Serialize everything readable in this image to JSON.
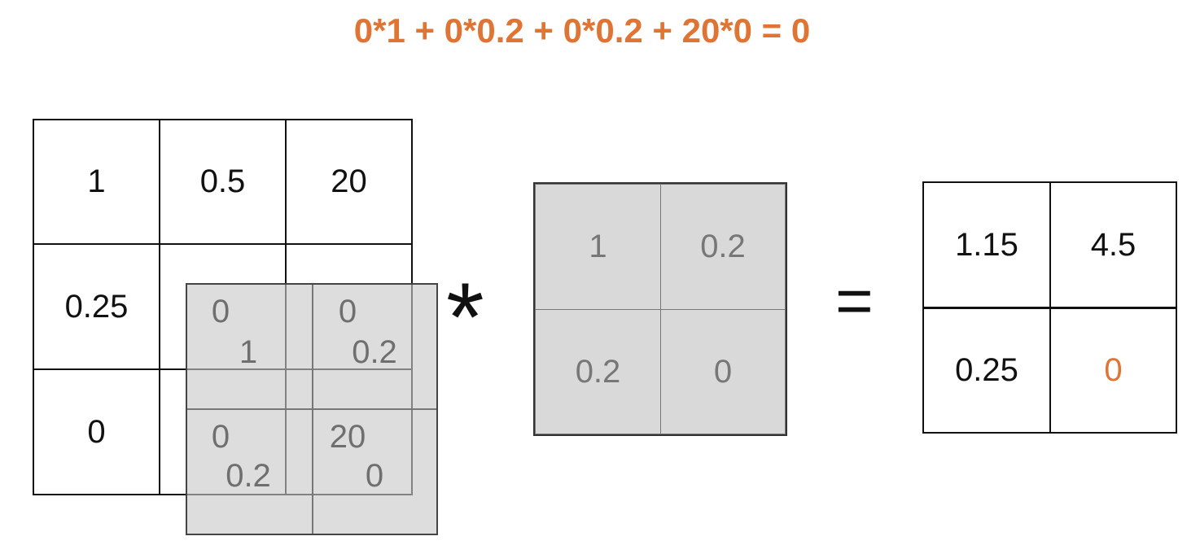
{
  "title": "0*1 + 0*0.2 + 0*0.2 + 20*0 = 0",
  "input_matrix": [
    [
      "1",
      "0.5",
      "20"
    ],
    [
      "0.25",
      "",
      ""
    ],
    [
      "0",
      "",
      ""
    ]
  ],
  "overlay": {
    "input_values": [
      "0",
      "0",
      "0",
      "20"
    ],
    "kernel_values": [
      "1",
      "0.2",
      "0.2",
      "0"
    ]
  },
  "operator": "*",
  "kernel": [
    [
      "1",
      "0.2"
    ],
    [
      "0.2",
      "0"
    ]
  ],
  "equals": "=",
  "output": [
    [
      "1.15",
      "4.5"
    ],
    [
      "0.25",
      "0"
    ]
  ],
  "colors": {
    "highlight": "#e07434",
    "kernel_bg": "#d9d9d9",
    "text": "#111111",
    "gray_text": "#777777"
  }
}
